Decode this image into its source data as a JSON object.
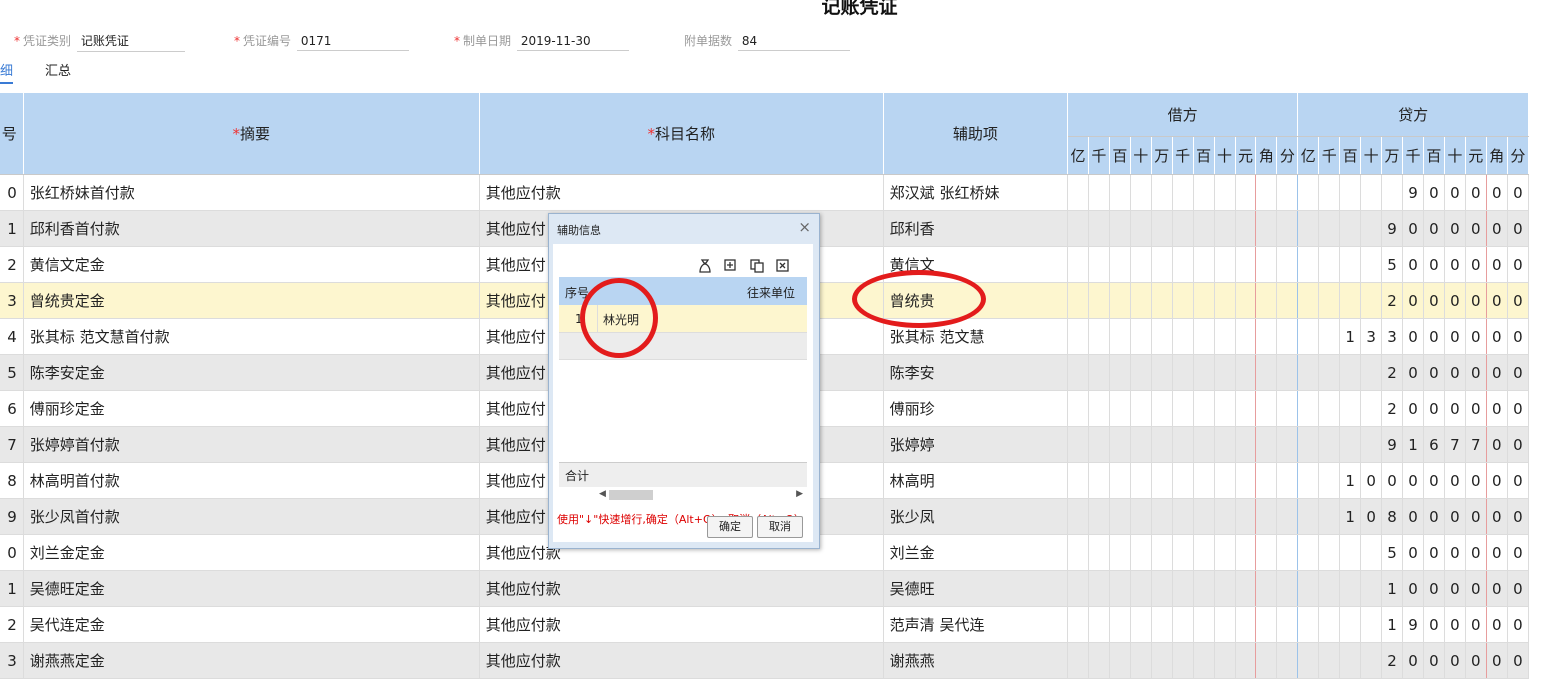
{
  "title": "记账凭证",
  "header": {
    "voucher_type_label": "凭证类别",
    "voucher_type_value": "记账凭证",
    "voucher_no_label": "凭证编号",
    "voucher_no_value": "0171",
    "date_label": "制单日期",
    "date_value": "2019-11-30",
    "attach_label": "附单据数",
    "attach_value": "84"
  },
  "tabs": [
    "细",
    "汇总"
  ],
  "columns": {
    "seq": "号",
    "summary": "摘要",
    "account": "科目名称",
    "aux": "辅助项",
    "debit": "借方",
    "credit": "贷方",
    "digits": [
      "亿",
      "千",
      "百",
      "十",
      "万",
      "千",
      "百",
      "十",
      "元",
      "角",
      "分"
    ]
  },
  "rows": [
    {
      "no": "0",
      "summary": "张红桥妹首付款",
      "account": "其他应付款",
      "aux": "郑汉斌 张红桥妹",
      "credit": "900000"
    },
    {
      "no": "1",
      "summary": "邱利香首付款",
      "account": "其他应付",
      "aux": "邱利香",
      "credit": "9000000"
    },
    {
      "no": "2",
      "summary": "黄信文定金",
      "account": "其他应付",
      "aux": "黄信文",
      "credit": "5000000"
    },
    {
      "no": "3",
      "summary": "曾统贵定金",
      "account": "其他应付",
      "aux": "曾统贵",
      "credit": "2000000"
    },
    {
      "no": "4",
      "summary": "张其标 范文慧首付款",
      "account": "其他应付",
      "aux": "张其标 范文慧",
      "credit": "133000000"
    },
    {
      "no": "5",
      "summary": "陈李安定金",
      "account": "其他应付",
      "aux": "陈李安",
      "credit": "2000000"
    },
    {
      "no": "6",
      "summary": "傅丽珍定金",
      "account": "其他应付",
      "aux": "傅丽珍",
      "credit": "2000000"
    },
    {
      "no": "7",
      "summary": "张婷婷首付款",
      "account": "其他应付",
      "aux": "张婷婷",
      "credit": "9167700"
    },
    {
      "no": "8",
      "summary": "林高明首付款",
      "account": "其他应付",
      "aux": "林高明",
      "credit": "100000000"
    },
    {
      "no": "9",
      "summary": "张少凤首付款",
      "account": "其他应付",
      "aux": "张少凤",
      "credit": "108000000"
    },
    {
      "no": "0",
      "summary": "刘兰金定金",
      "account": "其他应付款",
      "aux": "刘兰金",
      "credit": "5000000"
    },
    {
      "no": "1",
      "summary": "吴德旺定金",
      "account": "其他应付款",
      "aux": "吴德旺",
      "credit": "1000000"
    },
    {
      "no": "2",
      "summary": "吴代连定金",
      "account": "其他应付款",
      "aux": "范声清 吴代连",
      "credit": "1900000"
    },
    {
      "no": "3",
      "summary": "谢燕燕定金",
      "account": "其他应付款",
      "aux": "谢燕燕",
      "credit": "2000000"
    }
  ],
  "dialog": {
    "title": "辅助信息",
    "close": "×",
    "col_seq": "序号",
    "col_unit": "往来单位",
    "row_seq": "1",
    "row_unit": "林光明",
    "sum_label": "合计",
    "hint": "使用\"↓\"快速增行,确定（Alt+O）、取消（Alt+Q）",
    "ok": "确定",
    "cancel": "取消"
  }
}
